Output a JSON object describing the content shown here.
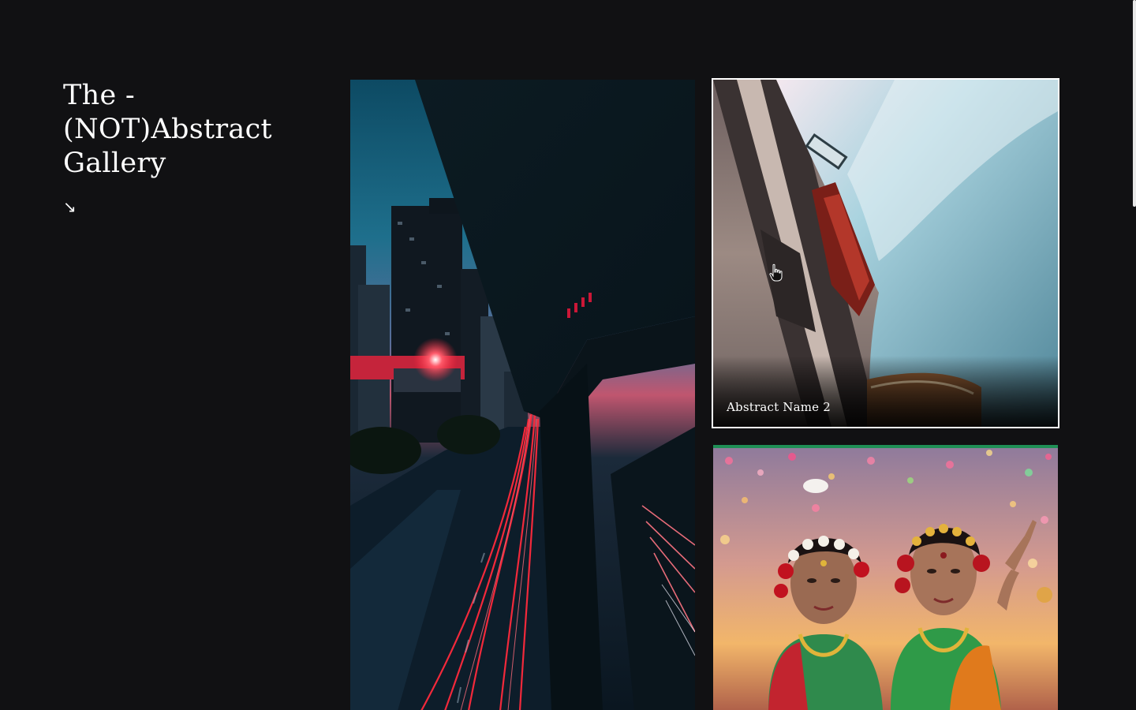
{
  "header": {
    "title_line1": "The -",
    "title_line2": "(NOT)Abstract",
    "title_line3": "Gallery",
    "scroll_arrow": "↘"
  },
  "gallery": {
    "items": [
      {
        "caption": "",
        "icon": "city-night-light-trails-image"
      },
      {
        "caption": "Abstract Name 2",
        "icon": "blue-car-closeup-image"
      },
      {
        "caption": "",
        "icon": "dancers-festival-image"
      }
    ]
  },
  "colors": {
    "background": "#111113",
    "text": "#ffffff",
    "hover_border": "#ffffff"
  }
}
